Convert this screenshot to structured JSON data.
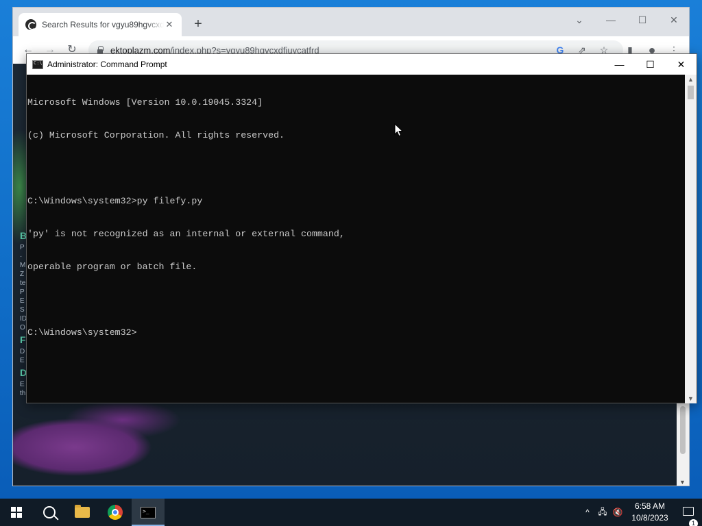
{
  "chrome": {
    "tab_title": "Search Results for vgyu89hgvcxdfiuvcatfrd",
    "tab_close_glyph": "✕",
    "new_tab_glyph": "+",
    "url_domain": "ektoplazm.com",
    "url_path": "/index.php?s=vgyu89hgvcxdfiuvcatfrd",
    "controls": {
      "tab_search": "⌄",
      "minimize": "—",
      "maximize": "☐",
      "close": "✕"
    },
    "nav": {
      "back": "←",
      "forward": "→",
      "reload": "↻"
    },
    "toolbar_icons": {
      "google": "G",
      "share": "⇗",
      "bookmark": "☆",
      "side_panel": "▮",
      "profile": "●",
      "menu": "⋮"
    }
  },
  "page": {
    "side_letters": [
      "B",
      "P",
      "·",
      "M",
      "Z",
      "te",
      "P",
      "E",
      "S",
      "ID",
      "O",
      "F",
      "D",
      "E",
      "D",
      "E",
      "th"
    ]
  },
  "cmd": {
    "title": "Administrator: Command Prompt",
    "controls": {
      "minimize": "—",
      "maximize": "☐",
      "close": "✕"
    },
    "lines": [
      "Microsoft Windows [Version 10.0.19045.3324]",
      "(c) Microsoft Corporation. All rights reserved.",
      "",
      "C:\\Windows\\system32>py filefy.py",
      "'py' is not recognized as an internal or external command,",
      "operable program or batch file.",
      "",
      "C:\\Windows\\system32>"
    ],
    "scroll_up": "▲",
    "scroll_down": "▼"
  },
  "taskbar": {
    "apps": [
      "start",
      "search",
      "file-explorer",
      "chrome",
      "command-prompt"
    ],
    "active_app": "command-prompt",
    "tray": {
      "chevron": "^",
      "network": "🖧",
      "volume": "🔇"
    },
    "time": "6:58 AM",
    "date": "10/8/2023",
    "notification_count": "1"
  },
  "colors": {
    "cmd_background": "#0c0c0c",
    "cmd_text": "#cccccc",
    "taskbar": "#101b26",
    "desktop": "#1778d2"
  }
}
